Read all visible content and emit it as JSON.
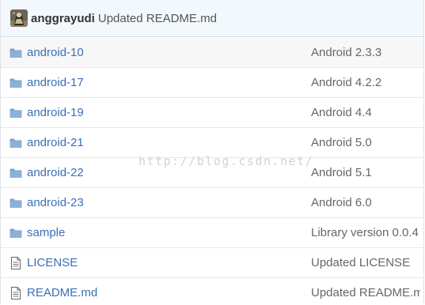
{
  "commit": {
    "author": "anggrayudi",
    "message": "Updated README.md"
  },
  "files": [
    {
      "type": "folder",
      "icon": "folder-icon",
      "name": "android-10",
      "message": "Android 2.3.3"
    },
    {
      "type": "folder",
      "icon": "folder-icon",
      "name": "android-17",
      "message": "Android 4.2.2"
    },
    {
      "type": "folder",
      "icon": "folder-icon",
      "name": "android-19",
      "message": "Android 4.4"
    },
    {
      "type": "folder",
      "icon": "folder-icon",
      "name": "android-21",
      "message": "Android 5.0"
    },
    {
      "type": "folder",
      "icon": "folder-icon",
      "name": "android-22",
      "message": "Android 5.1"
    },
    {
      "type": "folder",
      "icon": "folder-icon",
      "name": "android-23",
      "message": "Android 6.0"
    },
    {
      "type": "folder",
      "icon": "folder-icon",
      "name": "sample",
      "message": "Library version 0.0.4"
    },
    {
      "type": "file",
      "icon": "file-icon",
      "name": "LICENSE",
      "message": "Updated LICENSE"
    },
    {
      "type": "file",
      "icon": "file-icon",
      "name": "README.md",
      "message": "Updated README.md"
    }
  ],
  "watermark": "http://blog.csdn.net/",
  "colors": {
    "link": "#3b6fb5",
    "folder": "#7fa4cc",
    "header_bg": "#f2f8fc"
  }
}
